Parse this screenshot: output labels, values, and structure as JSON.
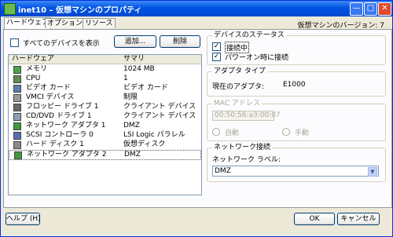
{
  "window": {
    "title": "inet10 – 仮想マシンのプロパティ"
  },
  "tabs": [
    "ハードウェア",
    "オプション",
    "リソース"
  ],
  "version_label": "仮想マシンのバージョン: 7",
  "hardware": {
    "show_all_label": "すべてのデバイスを表示",
    "add_button": "追加...",
    "remove_button": "削除",
    "columns": [
      "ハードウェア",
      "サマリ"
    ],
    "rows": [
      {
        "name": "メモリ",
        "summary": "1024 MB",
        "icon": "memory-icon",
        "color": "#4aa34a"
      },
      {
        "name": "CPU",
        "summary": "1",
        "icon": "cpu-icon",
        "color": "#5e8a52"
      },
      {
        "name": "ビデオ カード",
        "summary": "ビデオ カード",
        "icon": "monitor-icon",
        "color": "#5a7fb0"
      },
      {
        "name": "VMCI デバイス",
        "summary": "制限",
        "icon": "vmci-icon",
        "color": "#9b9b9b"
      },
      {
        "name": "フロッピー ドライブ 1",
        "summary": "クライアント デバイス",
        "icon": "floppy-icon",
        "color": "#6a6a6a"
      },
      {
        "name": "CD/DVD ドライブ 1",
        "summary": "クライアント デバイス",
        "icon": "cd-icon",
        "color": "#8fa0b5"
      },
      {
        "name": "ネットワーク アダプタ 1",
        "summary": "DMZ",
        "icon": "network-adapter-icon",
        "color": "#3e9a3e"
      },
      {
        "name": "SCSI コントローラ 0",
        "summary": "LSI Logic パラレル",
        "icon": "scsi-icon",
        "color": "#5c6cb0"
      },
      {
        "name": "ハード ディスク 1",
        "summary": "仮想ディスク",
        "icon": "disk-icon",
        "color": "#8a8a8a"
      },
      {
        "name": "ネットワーク アダプタ 2",
        "summary": "DMZ",
        "icon": "network-adapter-icon",
        "color": "#3e9a3e"
      }
    ]
  },
  "device_status": {
    "title": "デバイスのステータス",
    "connected_label": "接続中",
    "connect_at_power_on_label": "パワーオン時に接続"
  },
  "adapter_type": {
    "title": "アダプタ タイプ",
    "current_label": "現在のアダプタ:",
    "current_value": "E1000"
  },
  "mac_address": {
    "title": "MAC アドレス",
    "value": "00:50:56:a3:00:07",
    "auto_label": "自動",
    "manual_label": "手動"
  },
  "network_connection": {
    "title": "ネットワーク接続",
    "label": "ネットワーク ラベル:",
    "value": "DMZ"
  },
  "footer": {
    "help_button": "ヘルプ (H)",
    "ok_button": "OK",
    "cancel_button": "キャンセル"
  }
}
